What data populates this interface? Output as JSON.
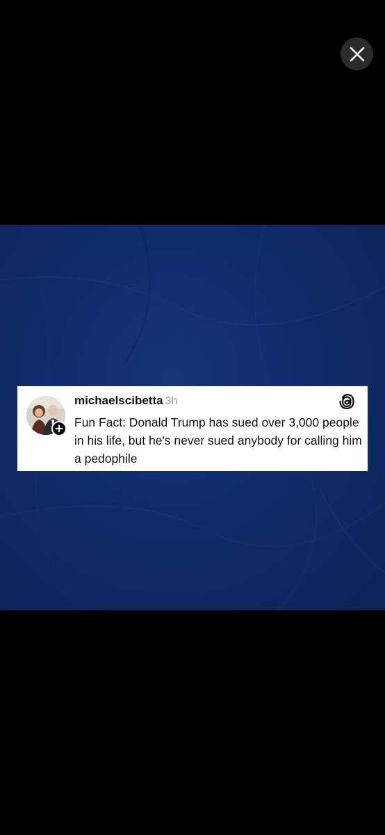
{
  "viewer": {
    "close_icon": "close-icon"
  },
  "post": {
    "username": "michaelscibetta",
    "timestamp": "3h",
    "text": "Fun Fact: Donald Trump has sued over 3,000 people in his life, but he's never sued anybody for calling him a pedophile",
    "avatar_icon": "avatar",
    "badge_icon": "plus-icon",
    "brand_icon": "threads-logo-icon"
  },
  "colors": {
    "background": "#000000",
    "panel_blue": "#112b69",
    "card": "#ffffff",
    "text": "#111111",
    "timestamp": "#9a9a9a"
  }
}
